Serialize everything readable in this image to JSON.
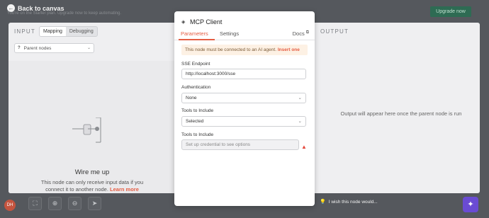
{
  "topbar": {
    "back_label": "Back to canvas",
    "banner_text": "You're on the Starter plan. Upgrade now to keep automating.",
    "upgrade_label": "Upgrade now"
  },
  "input": {
    "title": "INPUT",
    "mode_tabs": [
      "Mapping",
      "Debugging"
    ],
    "active_mode": "Mapping",
    "parent_select": "Parent nodes",
    "empty_title": "Wire me up",
    "empty_text": "This node can only receive input data if you connect it to another node.",
    "learn_more": "Learn more"
  },
  "output": {
    "title": "OUTPUT",
    "message": "Output will appear here once the parent node is run"
  },
  "modal": {
    "title": "MCP Client",
    "tabs": [
      "Parameters",
      "Settings"
    ],
    "active_tab": "Parameters",
    "docs_label": "Docs",
    "notice_text": "This node must be connected to an AI agent.",
    "notice_link": "Insert one",
    "sse_label": "SSE Endpoint",
    "sse_value": "http://localhost:3000/sse",
    "auth_label": "Authentication",
    "auth_value": "None",
    "tools_label": "Tools to Include",
    "tools_value": "Selected",
    "tools2_label": "Tools to Include",
    "tools2_placeholder": "Set up credential to see options"
  },
  "footer": {
    "avatar_initials": "DH",
    "wish_label": "I wish this node would..."
  },
  "colors": {
    "accent": "#e55d43",
    "ai_button": "#6a4bd3",
    "upgrade": "#2e6b53",
    "warning": "#e5483b"
  }
}
